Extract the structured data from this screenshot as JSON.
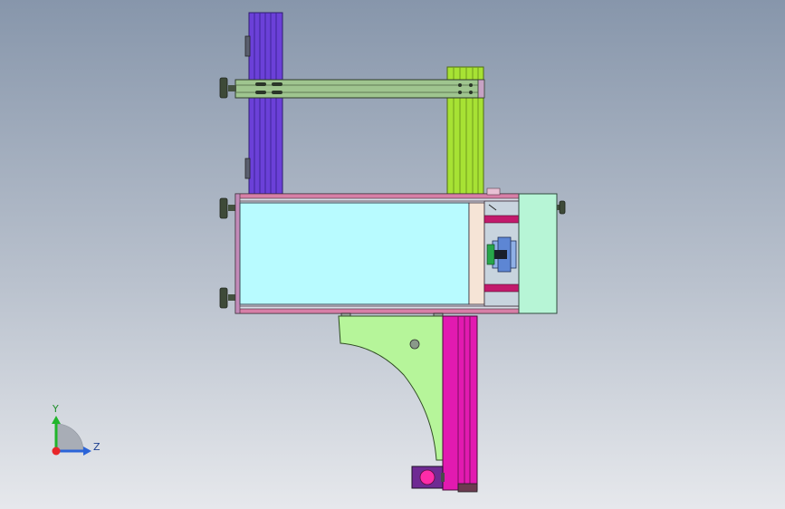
{
  "triad": {
    "y_label": "Y",
    "z_label": "Z",
    "colors": {
      "x": "#e8262a",
      "y": "#21b52b",
      "z": "#2b64d8"
    }
  },
  "colors": {
    "background_top": "#8796ab",
    "background_bottom": "#e6e8ec",
    "purple_column": "#6b40d8",
    "green_column": "#a7e234",
    "rail": "#9fc58f",
    "tank_glass": "#b8fbff",
    "tank_frame": "#d77fa7",
    "bracket": "#b6f59a",
    "magenta_post": "#e21ab0",
    "motor_box": "#b7f5d6"
  }
}
